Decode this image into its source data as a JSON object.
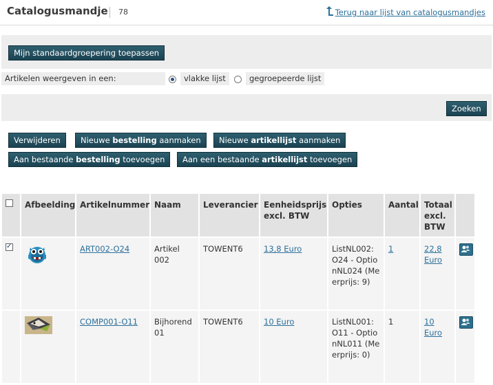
{
  "header": {
    "title": "Catalogusmandje",
    "count": "78",
    "back_link": "Terug naar lijst van catalogusmandjes"
  },
  "actions": {
    "apply_grouping": "Mijn standaardgroepering toepassen",
    "display_label": "Artikelen weergeven in een:",
    "flat_list": "vlakke lijst",
    "grouped_list": "gegroepeerde lijst",
    "selected_view": "vlakke lijst",
    "search": "Zoeken",
    "delete": "Verwijderen",
    "new_order_pre": "Nieuwe ",
    "new_order_bold": "bestelling",
    "new_order_post": " aanmaken",
    "new_list_pre": "Nieuwe ",
    "new_list_bold": "artikellijst",
    "new_list_post": " aanmaken",
    "add_order_pre": "Aan bestaande ",
    "add_order_bold": "bestelling",
    "add_order_post": " toevoegen",
    "add_list_pre": "Aan een bestaande ",
    "add_list_bold": "artikellijst",
    "add_list_post": " toevoegen"
  },
  "table": {
    "columns": {
      "image": "Afbeelding",
      "article_number": "Artikelnummer",
      "name": "Naam",
      "supplier": "Leverancier",
      "unit_price": "Eenheidsprijs excl. BTW",
      "options": "Opties",
      "quantity": "Aantal",
      "total": "Totaal excl. BTW"
    },
    "rows": [
      {
        "checked": true,
        "image": "blue-monster-icon",
        "article_number": "ART002-O24",
        "name": "Artikel 002",
        "supplier": "TOWENT6",
        "unit_price": "13,8 Euro",
        "options": "ListNL002: O24 - OptionNL024 (Meerprijs: 9)",
        "quantity": "1",
        "total": "22,8 Euro"
      },
      {
        "checked": false,
        "image": "origami-bird-icon",
        "article_number": "COMP001-O11",
        "name": "Bijhorend 01",
        "supplier": "TOWENT6",
        "unit_price": "10 Euro",
        "options": "ListNL001: O11 - OptionNL011 (Meerprijs: 0)",
        "quantity": "1",
        "total": "10 Euro"
      }
    ]
  },
  "colors": {
    "button": "#1f4b5a",
    "link": "#2b6f9a",
    "panel": "#ededed"
  }
}
